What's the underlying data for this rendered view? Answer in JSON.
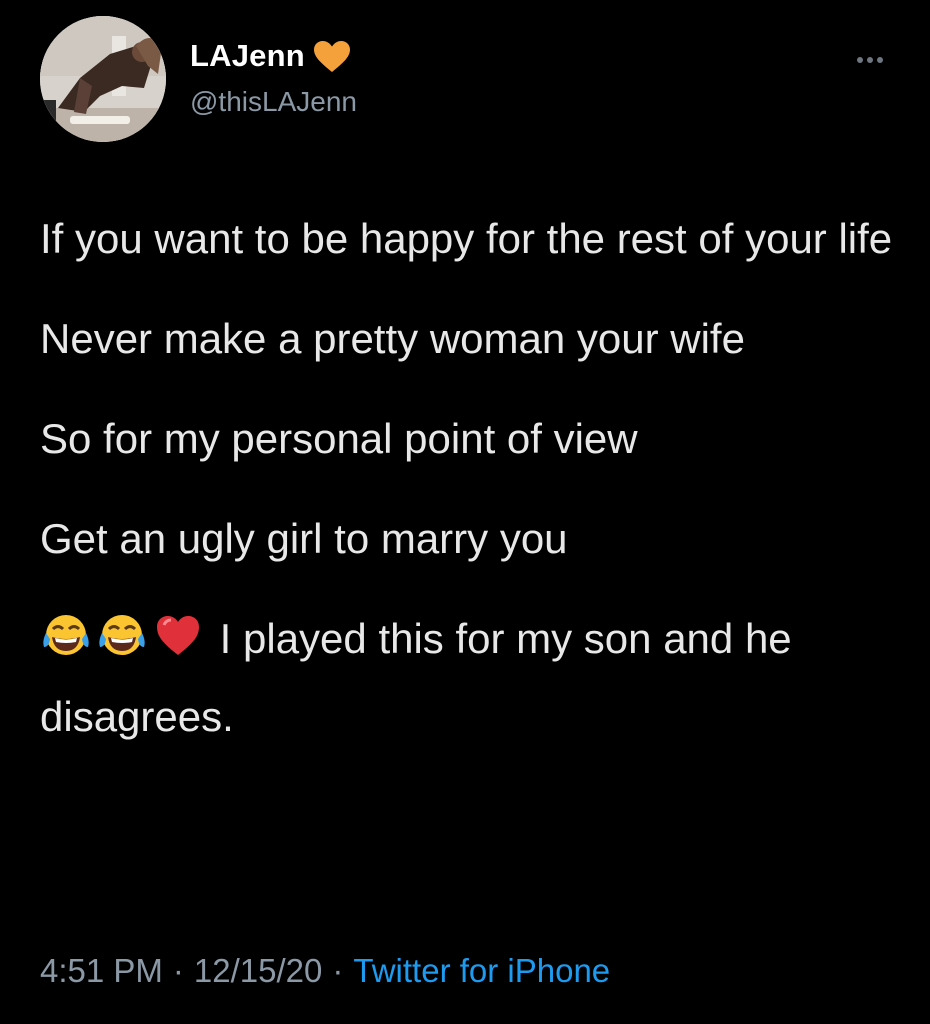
{
  "user": {
    "display_name": "LAJenn",
    "handle": "@thisLAJenn",
    "badge_icon": "orange-heart-icon",
    "badge_color": "#f5a13b"
  },
  "tweet": {
    "paragraphs": [
      "If you want to be happy for the rest of your life",
      "Never make a pretty woman your wife",
      "So for my personal point of view",
      "Get an ugly girl to marry you"
    ],
    "last_paragraph_text": "I played this for my son and he disagrees.",
    "last_paragraph_emojis": [
      "tears-of-joy-emoji",
      "tears-of-joy-emoji",
      "red-heart-emoji"
    ]
  },
  "meta": {
    "time": "4:51 PM",
    "separator": "·",
    "date": "12/15/20",
    "source": "Twitter for iPhone",
    "link_color": "#1d9bf0"
  },
  "menu": {
    "more_icon": "ellipsis-icon"
  }
}
